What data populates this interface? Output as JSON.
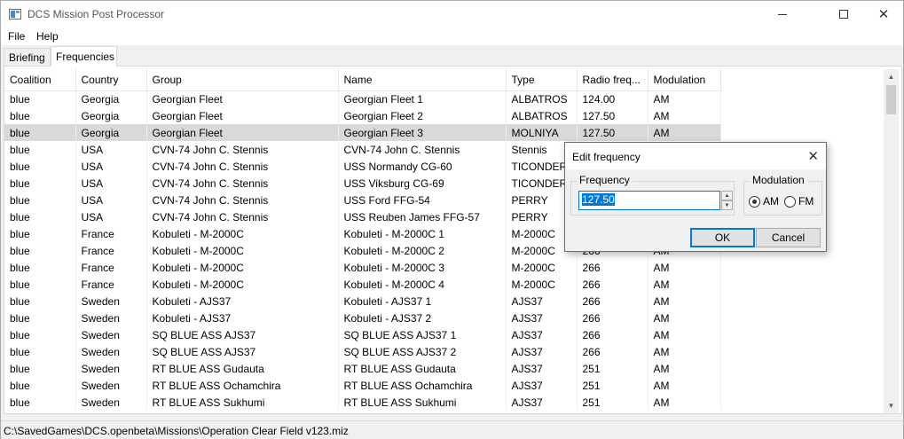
{
  "window": {
    "title": "DCS Mission Post Processor",
    "min_symbol": "",
    "close_symbol": "✕"
  },
  "menu": {
    "file": "File",
    "help": "Help"
  },
  "tabs": [
    {
      "label": "Briefing",
      "selected": false
    },
    {
      "label": "Frequencies",
      "selected": true
    }
  ],
  "table": {
    "columns": [
      "Coalition",
      "Country",
      "Group",
      "Name",
      "Type",
      "Radio freq...",
      "Modulation"
    ],
    "selected_row": 2,
    "rows": [
      [
        "blue",
        "Georgia",
        "Georgian Fleet",
        "Georgian Fleet 1",
        "ALBATROS",
        "124.00",
        "AM"
      ],
      [
        "blue",
        "Georgia",
        "Georgian Fleet",
        "Georgian Fleet 2",
        "ALBATROS",
        "127.50",
        "AM"
      ],
      [
        "blue",
        "Georgia",
        "Georgian Fleet",
        "Georgian Fleet 3",
        "MOLNIYA",
        "127.50",
        "AM"
      ],
      [
        "blue",
        "USA",
        "CVN-74 John C. Stennis",
        "CVN-74 John C. Stennis",
        "Stennis",
        "",
        ""
      ],
      [
        "blue",
        "USA",
        "CVN-74 John C. Stennis",
        "USS Normandy CG-60",
        "TICONDER",
        "",
        ""
      ],
      [
        "blue",
        "USA",
        "CVN-74 John C. Stennis",
        "USS Viksburg CG-69",
        "TICONDER",
        "",
        ""
      ],
      [
        "blue",
        "USA",
        "CVN-74 John C. Stennis",
        "USS Ford FFG-54",
        "PERRY",
        "",
        ""
      ],
      [
        "blue",
        "USA",
        "CVN-74 John C. Stennis",
        "USS Reuben James FFG-57",
        "PERRY",
        "",
        ""
      ],
      [
        "blue",
        "France",
        "Kobuleti - M-2000C",
        "Kobuleti - M-2000C 1",
        "M-2000C",
        "",
        ""
      ],
      [
        "blue",
        "France",
        "Kobuleti - M-2000C",
        "Kobuleti - M-2000C 2",
        "M-2000C",
        "266",
        "AM"
      ],
      [
        "blue",
        "France",
        "Kobuleti - M-2000C",
        "Kobuleti - M-2000C 3",
        "M-2000C",
        "266",
        "AM"
      ],
      [
        "blue",
        "France",
        "Kobuleti - M-2000C",
        "Kobuleti - M-2000C 4",
        "M-2000C",
        "266",
        "AM"
      ],
      [
        "blue",
        "Sweden",
        "Kobuleti - AJS37",
        "Kobuleti - AJS37 1",
        "AJS37",
        "266",
        "AM"
      ],
      [
        "blue",
        "Sweden",
        "Kobuleti - AJS37",
        "Kobuleti - AJS37 2",
        "AJS37",
        "266",
        "AM"
      ],
      [
        "blue",
        "Sweden",
        "SQ BLUE ASS AJS37",
        "SQ BLUE ASS AJS37 1",
        "AJS37",
        "266",
        "AM"
      ],
      [
        "blue",
        "Sweden",
        "SQ BLUE ASS AJS37",
        "SQ BLUE ASS AJS37 2",
        "AJS37",
        "266",
        "AM"
      ],
      [
        "blue",
        "Sweden",
        "RT BLUE ASS Gudauta",
        "RT BLUE ASS Gudauta",
        "AJS37",
        "251",
        "AM"
      ],
      [
        "blue",
        "Sweden",
        "RT BLUE ASS Ochamchira",
        "RT BLUE ASS Ochamchira",
        "AJS37",
        "251",
        "AM"
      ],
      [
        "blue",
        "Sweden",
        "RT BLUE ASS Sukhumi",
        "RT BLUE ASS Sukhumi",
        "AJS37",
        "251",
        "AM"
      ]
    ]
  },
  "scrollbar": {
    "up": "▲",
    "down": "▼"
  },
  "status": {
    "path": "C:\\SavedGames\\DCS.openbeta\\Missions\\Operation Clear Field v123.miz"
  },
  "dialog": {
    "title": "Edit frequency",
    "close_symbol": "✕",
    "frequency_label": "Frequency",
    "frequency_value": "127.50",
    "spin_up": "▲",
    "spin_down": "▼",
    "modulation_label": "Modulation",
    "am_label": "AM",
    "fm_label": "FM",
    "am_checked": true,
    "ok_label": "OK",
    "cancel_label": "Cancel"
  },
  "colors": {
    "accent": "#0078d7",
    "selected_row": "#d9d9d9"
  }
}
